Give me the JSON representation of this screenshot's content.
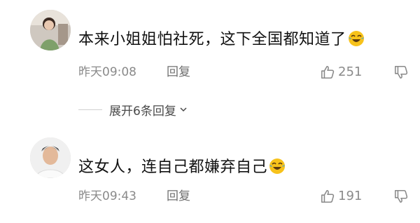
{
  "comments": [
    {
      "text": "本来小姐姐怕社死，这下全国都知道了",
      "emoji": "laughing-crying-emoji",
      "time": "昨天09:08",
      "reply_label": "回复",
      "likes": "251",
      "avatar": "user-avatar-photo"
    },
    {
      "text": "这女人，连自己都嫌弃自己",
      "emoji": "laughing-crying-emoji",
      "time": "昨天09:43",
      "reply_label": "回复",
      "likes": "191",
      "avatar": "user-avatar-photo"
    }
  ],
  "expand_replies": {
    "label": "展开6条回复",
    "icon": "chevron-down-icon"
  },
  "colors": {
    "text": "#111111",
    "meta": "#8a8a8a",
    "background": "#ffffff",
    "emoji": "#f7c21b"
  }
}
